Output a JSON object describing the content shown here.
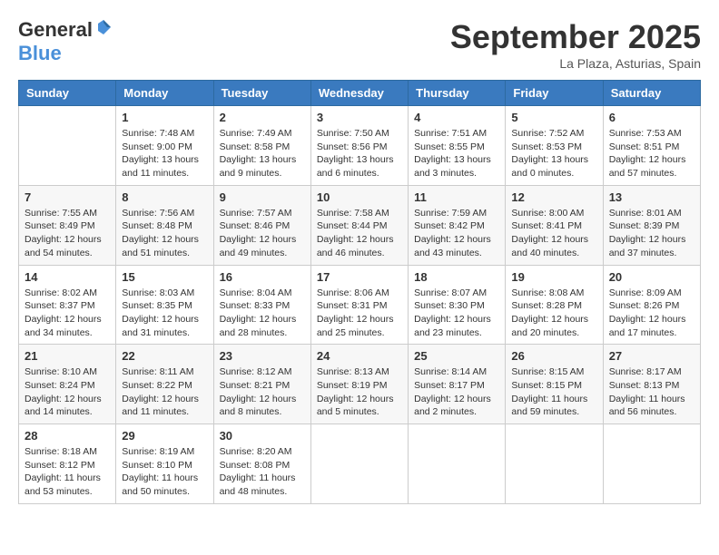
{
  "logo": {
    "general": "General",
    "blue": "Blue"
  },
  "title": "September 2025",
  "location": "La Plaza, Asturias, Spain",
  "weekdays": [
    "Sunday",
    "Monday",
    "Tuesday",
    "Wednesday",
    "Thursday",
    "Friday",
    "Saturday"
  ],
  "weeks": [
    [
      {
        "day": "",
        "info": ""
      },
      {
        "day": "1",
        "info": "Sunrise: 7:48 AM\nSunset: 9:00 PM\nDaylight: 13 hours\nand 11 minutes."
      },
      {
        "day": "2",
        "info": "Sunrise: 7:49 AM\nSunset: 8:58 PM\nDaylight: 13 hours\nand 9 minutes."
      },
      {
        "day": "3",
        "info": "Sunrise: 7:50 AM\nSunset: 8:56 PM\nDaylight: 13 hours\nand 6 minutes."
      },
      {
        "day": "4",
        "info": "Sunrise: 7:51 AM\nSunset: 8:55 PM\nDaylight: 13 hours\nand 3 minutes."
      },
      {
        "day": "5",
        "info": "Sunrise: 7:52 AM\nSunset: 8:53 PM\nDaylight: 13 hours\nand 0 minutes."
      },
      {
        "day": "6",
        "info": "Sunrise: 7:53 AM\nSunset: 8:51 PM\nDaylight: 12 hours\nand 57 minutes."
      }
    ],
    [
      {
        "day": "7",
        "info": "Sunrise: 7:55 AM\nSunset: 8:49 PM\nDaylight: 12 hours\nand 54 minutes."
      },
      {
        "day": "8",
        "info": "Sunrise: 7:56 AM\nSunset: 8:48 PM\nDaylight: 12 hours\nand 51 minutes."
      },
      {
        "day": "9",
        "info": "Sunrise: 7:57 AM\nSunset: 8:46 PM\nDaylight: 12 hours\nand 49 minutes."
      },
      {
        "day": "10",
        "info": "Sunrise: 7:58 AM\nSunset: 8:44 PM\nDaylight: 12 hours\nand 46 minutes."
      },
      {
        "day": "11",
        "info": "Sunrise: 7:59 AM\nSunset: 8:42 PM\nDaylight: 12 hours\nand 43 minutes."
      },
      {
        "day": "12",
        "info": "Sunrise: 8:00 AM\nSunset: 8:41 PM\nDaylight: 12 hours\nand 40 minutes."
      },
      {
        "day": "13",
        "info": "Sunrise: 8:01 AM\nSunset: 8:39 PM\nDaylight: 12 hours\nand 37 minutes."
      }
    ],
    [
      {
        "day": "14",
        "info": "Sunrise: 8:02 AM\nSunset: 8:37 PM\nDaylight: 12 hours\nand 34 minutes."
      },
      {
        "day": "15",
        "info": "Sunrise: 8:03 AM\nSunset: 8:35 PM\nDaylight: 12 hours\nand 31 minutes."
      },
      {
        "day": "16",
        "info": "Sunrise: 8:04 AM\nSunset: 8:33 PM\nDaylight: 12 hours\nand 28 minutes."
      },
      {
        "day": "17",
        "info": "Sunrise: 8:06 AM\nSunset: 8:31 PM\nDaylight: 12 hours\nand 25 minutes."
      },
      {
        "day": "18",
        "info": "Sunrise: 8:07 AM\nSunset: 8:30 PM\nDaylight: 12 hours\nand 23 minutes."
      },
      {
        "day": "19",
        "info": "Sunrise: 8:08 AM\nSunset: 8:28 PM\nDaylight: 12 hours\nand 20 minutes."
      },
      {
        "day": "20",
        "info": "Sunrise: 8:09 AM\nSunset: 8:26 PM\nDaylight: 12 hours\nand 17 minutes."
      }
    ],
    [
      {
        "day": "21",
        "info": "Sunrise: 8:10 AM\nSunset: 8:24 PM\nDaylight: 12 hours\nand 14 minutes."
      },
      {
        "day": "22",
        "info": "Sunrise: 8:11 AM\nSunset: 8:22 PM\nDaylight: 12 hours\nand 11 minutes."
      },
      {
        "day": "23",
        "info": "Sunrise: 8:12 AM\nSunset: 8:21 PM\nDaylight: 12 hours\nand 8 minutes."
      },
      {
        "day": "24",
        "info": "Sunrise: 8:13 AM\nSunset: 8:19 PM\nDaylight: 12 hours\nand 5 minutes."
      },
      {
        "day": "25",
        "info": "Sunrise: 8:14 AM\nSunset: 8:17 PM\nDaylight: 12 hours\nand 2 minutes."
      },
      {
        "day": "26",
        "info": "Sunrise: 8:15 AM\nSunset: 8:15 PM\nDaylight: 11 hours\nand 59 minutes."
      },
      {
        "day": "27",
        "info": "Sunrise: 8:17 AM\nSunset: 8:13 PM\nDaylight: 11 hours\nand 56 minutes."
      }
    ],
    [
      {
        "day": "28",
        "info": "Sunrise: 8:18 AM\nSunset: 8:12 PM\nDaylight: 11 hours\nand 53 minutes."
      },
      {
        "day": "29",
        "info": "Sunrise: 8:19 AM\nSunset: 8:10 PM\nDaylight: 11 hours\nand 50 minutes."
      },
      {
        "day": "30",
        "info": "Sunrise: 8:20 AM\nSunset: 8:08 PM\nDaylight: 11 hours\nand 48 minutes."
      },
      {
        "day": "",
        "info": ""
      },
      {
        "day": "",
        "info": ""
      },
      {
        "day": "",
        "info": ""
      },
      {
        "day": "",
        "info": ""
      }
    ]
  ]
}
